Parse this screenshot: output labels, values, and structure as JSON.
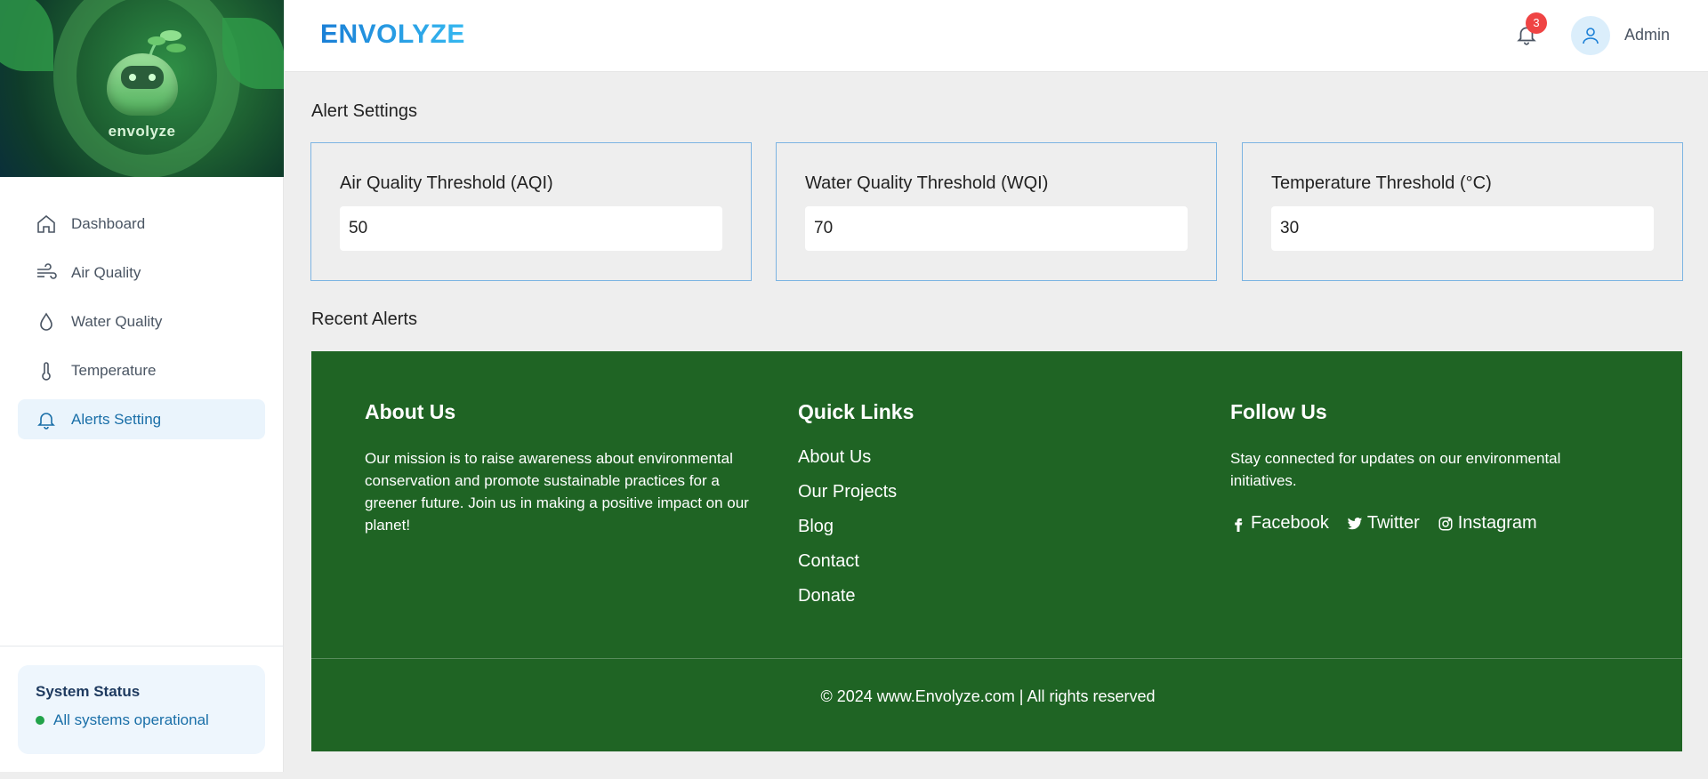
{
  "sidebar": {
    "logo_text": "envolyze",
    "items": [
      {
        "label": "Dashboard",
        "icon": "home-icon"
      },
      {
        "label": "Air Quality",
        "icon": "wind-icon"
      },
      {
        "label": "Water Quality",
        "icon": "droplet-icon"
      },
      {
        "label": "Temperature",
        "icon": "thermometer-icon"
      },
      {
        "label": "Alerts Setting",
        "icon": "bell-icon",
        "active": true
      }
    ],
    "status": {
      "title": "System Status",
      "text": "All systems operational",
      "color": "#22a34a"
    }
  },
  "header": {
    "brand": "ENVOLYZE",
    "notification_count": "3",
    "user_name": "Admin"
  },
  "main": {
    "alert_settings_title": "Alert Settings",
    "thresholds": [
      {
        "label": "Air Quality Threshold (AQI)",
        "value": "50"
      },
      {
        "label": "Water Quality Threshold (WQI)",
        "value": "70"
      },
      {
        "label": "Temperature Threshold (°C)",
        "value": "30"
      }
    ],
    "recent_alerts_title": "Recent Alerts"
  },
  "footer": {
    "about": {
      "heading": "About Us",
      "text": "Our mission is to raise awareness about environmental conservation and promote sustainable practices for a greener future. Join us in making a positive impact on our planet!"
    },
    "quick_links": {
      "heading": "Quick Links",
      "links": [
        "About Us",
        "Our Projects",
        "Blog",
        "Contact",
        "Donate"
      ]
    },
    "follow": {
      "heading": "Follow Us",
      "text": "Stay connected for updates on our environmental initiatives.",
      "socials": [
        "Facebook",
        "Twitter",
        "Instagram"
      ]
    },
    "copyright": "© 2024 www.Envolyze.com | All rights reserved"
  },
  "colors": {
    "footer_bg": "#1f6424",
    "accent": "#1a6fa8",
    "badge": "#ef4444"
  }
}
